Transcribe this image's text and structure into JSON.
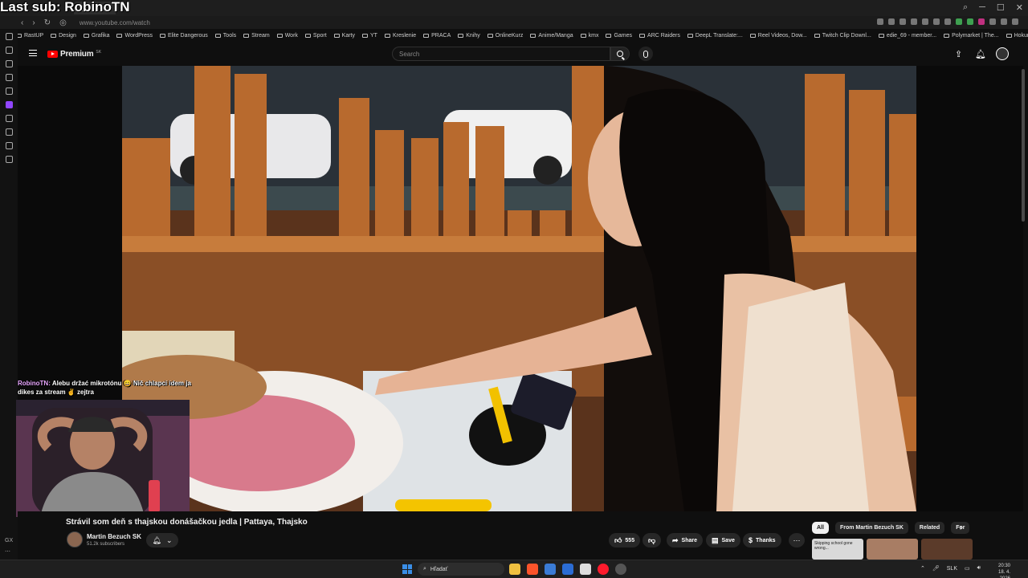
{
  "overlay": {
    "last_sub": "Last sub: RobinoTN",
    "chat_user": "RobinoTN:",
    "chat_message": "Alebu držać mikrotónu 😄 Nič chlapci idem ja dikes za stream ✌ zejtra"
  },
  "browser": {
    "tab_title": "",
    "url": "www.youtube.com/watch",
    "bookmarks": [
      "RastUP",
      "Design",
      "Grafika",
      "WordPress",
      "Elite Dangerous",
      "Tools",
      "Stream",
      "Work",
      "Sport",
      "Karty",
      "YT",
      "Kreslenie",
      "PRACA",
      "Knihy",
      "OnlineKurz",
      "Anime/Manga",
      "kmx",
      "Games",
      "ARC Raiders",
      "DeepL Translate:...",
      "Reel Videos, Dow...",
      "Twitch Clip Downl...",
      "edie_69 - member...",
      "Polymarket | The...",
      "Hokuro"
    ]
  },
  "youtube": {
    "logo_text": "Premium",
    "region": "SK",
    "search_placeholder": "Search",
    "video_title": "Strávil som deň s thajskou donášačkou jedla | Pattaya, Thajsko",
    "channel_name": "Martin Bezuch SK",
    "subscribers": "51.2k subscribers",
    "like_count": "555",
    "share_label": "Share",
    "save_label": "Save",
    "thanks_label": "Thanks",
    "chips": [
      "All",
      "From Martin Bezuch SK",
      "Related",
      "For"
    ],
    "thumb_text": "Skipping school gone wrong..."
  },
  "side_panel": {
    "bottom_label": "GX"
  },
  "taskbar": {
    "search_label": "Hľadať",
    "lang": "SLK",
    "time": "20:30",
    "date": "18. 4. 2026"
  },
  "colors": {
    "yt_red": "#ff0000",
    "background": "#0f0f0f",
    "chat_user": "#e9a7ff"
  }
}
